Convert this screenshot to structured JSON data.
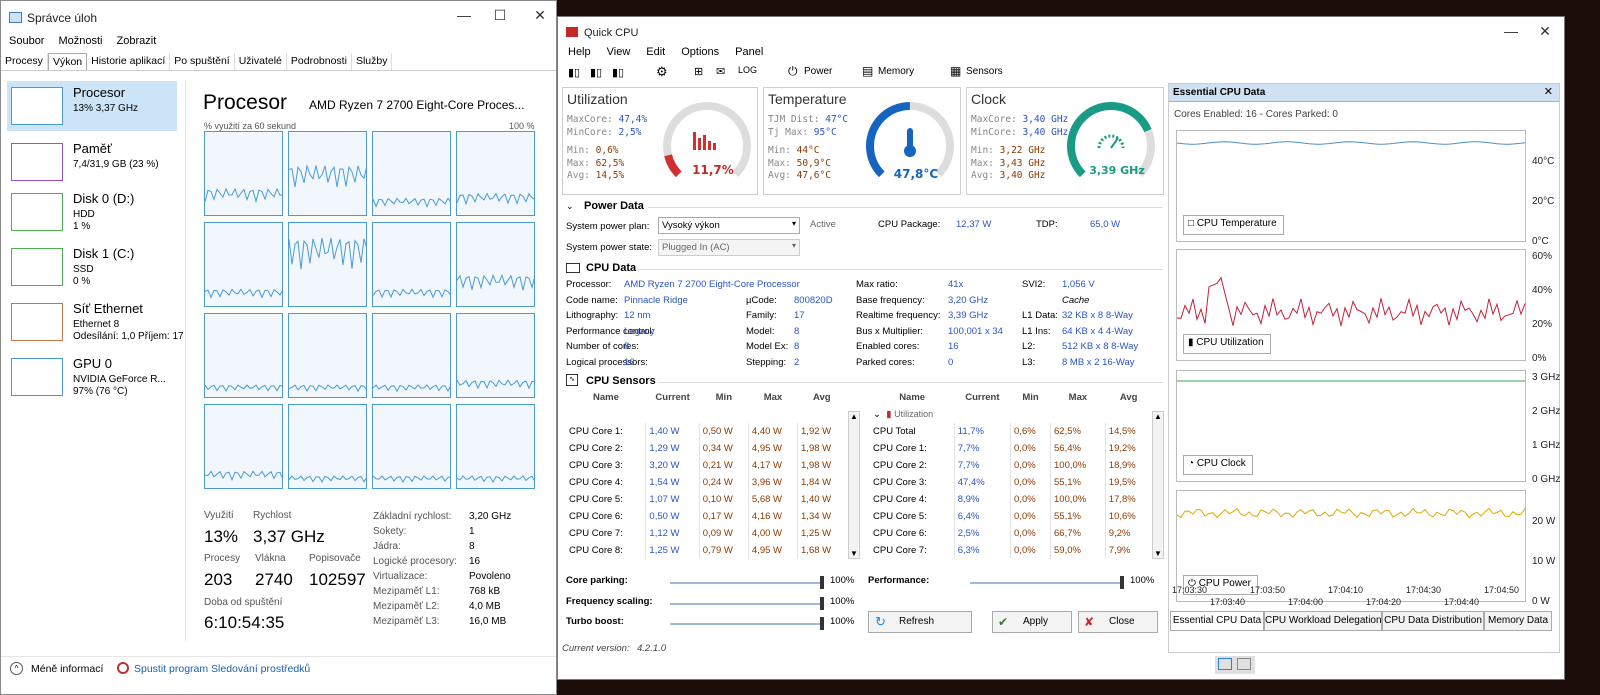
{
  "colors": {
    "accent": "#2a82da",
    "cpuBlue": "#4a9ad4",
    "memPurple": "#a04fc7",
    "diskGreen": "#4caf50",
    "netOrange": "#c5784a",
    "red": "#d32f2f",
    "tempBlue": "#1565c0",
    "clockTeal": "#1a9b86",
    "utilRed": "#c51f3a",
    "powerGold": "#e0a800",
    "cpuTempLine": "#4a90c8"
  },
  "taskmgr": {
    "title": "Správce úloh",
    "menu": [
      "Soubor",
      "Možnosti",
      "Zobrazit"
    ],
    "tabs": [
      "Procesy",
      "Výkon",
      "Historie aplikací",
      "Po spuštění",
      "Uživatelé",
      "Podrobnosti",
      "Služby"
    ],
    "active_tab": "Výkon",
    "sidebar": [
      {
        "name": "Procesor",
        "line1": "13% 3,37 GHz",
        "line2": "",
        "color": "#4a9ad4",
        "icon": "cpu-graph-icon"
      },
      {
        "name": "Paměť",
        "line1": "7,4/31,9 GB (23 %)",
        "line2": "",
        "color": "#a04fc7",
        "icon": "memory-graph-icon"
      },
      {
        "name": "Disk 0 (D:)",
        "line1": "HDD",
        "line2": "1 %",
        "color": "#4caf50",
        "icon": "disk-graph-icon"
      },
      {
        "name": "Disk 1 (C:)",
        "line1": "SSD",
        "line2": "0 %",
        "color": "#4caf50",
        "icon": "disk-graph-icon"
      },
      {
        "name": "Síť Ethernet",
        "line1": "Ethernet 8",
        "line2": "Odesílání: 1,0 Příjem: 17",
        "color": "#c5784a",
        "icon": "network-graph-icon"
      },
      {
        "name": "GPU 0",
        "line1": "NVIDIA GeForce R...",
        "line2": "97% (76 °C)",
        "color": "#4a9ad4",
        "icon": "gpu-graph-icon"
      }
    ],
    "heading": "Procesor",
    "cpu_model": "AMD Ryzen 7 2700 Eight-Core Proces...",
    "graph_caption": "% využití za 60 sekund",
    "graph_max": "100 %",
    "cell_levels": [
      0.3,
      0.55,
      0.2,
      0.25,
      0.2,
      0.75,
      0.2,
      0.35,
      0.15,
      0.15,
      0.15,
      0.2,
      0.2,
      0.15,
      0.15,
      0.15
    ],
    "stats": {
      "util_label": "Využití",
      "util_value": "13%",
      "speed_label": "Rychlost",
      "speed_value": "3,37 GHz",
      "proc_label": "Procesy",
      "proc_value": "203",
      "threads_label": "Vlákna",
      "threads_value": "2740",
      "handles_label": "Popisovače",
      "handles_value": "102597",
      "uptime_label": "Doba od spuštění",
      "uptime_value": "6:10:54:35"
    },
    "details": [
      {
        "k": "Základní rychlost:",
        "v": "3,20 GHz"
      },
      {
        "k": "Sokety:",
        "v": "1"
      },
      {
        "k": "Jádra:",
        "v": "8"
      },
      {
        "k": "Logické procesory:",
        "v": "16"
      },
      {
        "k": "Virtualizace:",
        "v": "Povoleno"
      },
      {
        "k": "Mezipaměť L1:",
        "v": "768 kB"
      },
      {
        "k": "Mezipaměť L2:",
        "v": "4,0 MB"
      },
      {
        "k": "Mezipaměť L3:",
        "v": "16,0 MB"
      }
    ],
    "footer_less": "Méně informací",
    "footer_monitor": "Spustit program Sledování prostředků"
  },
  "quickcpu": {
    "title": "Quick CPU",
    "menu": [
      "Help",
      "View",
      "Edit",
      "Options",
      "Panel"
    ],
    "toolbar": {
      "power": "Power",
      "memory": "Memory",
      "sensors": "Sensors"
    },
    "util": {
      "title": "Utilization",
      "lines": [
        [
          "MaxCore:",
          "47,4%"
        ],
        [
          "MinCore:",
          "2,5%"
        ],
        [
          "Min:",
          "0,6%"
        ],
        [
          "Max:",
          "62,5%"
        ],
        [
          "Avg:",
          "14,5%"
        ]
      ],
      "value": "11,7%",
      "level": 0.117
    },
    "temp": {
      "title": "Temperature",
      "lines": [
        [
          "TJM Dist:",
          "47°C"
        ],
        [
          "Tj Max:",
          "95°C"
        ],
        [
          "Min:",
          "44°C"
        ],
        [
          "Max:",
          "50,9°C"
        ],
        [
          "Avg:",
          "47,6°C"
        ]
      ],
      "value": "47,8°C",
      "level": 0.5
    },
    "clock": {
      "title": "Clock",
      "lines": [
        [
          "MaxCore:",
          "3,40 GHz"
        ],
        [
          "MinCore:",
          "3,40 GHz"
        ],
        [
          "Min:",
          "3,22 GHz"
        ],
        [
          "Max:",
          "3,43 GHz"
        ],
        [
          "Avg:",
          "3,40 GHz"
        ]
      ],
      "value": "3,39 GHz",
      "level": 0.75
    },
    "power_data": {
      "header": "Power Data",
      "plan_label": "System power plan:",
      "plan_value": "Vysoký výkon",
      "plan_state": "Active",
      "state_label": "System power state:",
      "state_value": "Plugged In (AC)",
      "pkg_label": "CPU Package:",
      "pkg_value": "12,37 W",
      "tdp_label": "TDP:",
      "tdp_value": "65,0 W"
    },
    "cpu_data": {
      "header": "CPU Data",
      "col1": [
        [
          "Processor:",
          "AMD Ryzen 7 2700 Eight-Core Processor"
        ],
        [
          "Code name:",
          "Pinnacle Ridge"
        ],
        [
          "Lithography:",
          "12 nm"
        ],
        [
          "Performance control:",
          "Legacy"
        ],
        [
          "Number of cores:",
          "8"
        ],
        [
          "Logical processors:",
          "16"
        ]
      ],
      "col2": [
        [
          "",
          ""
        ],
        [
          "µCode:",
          "800820D"
        ],
        [
          "Family:",
          "17"
        ],
        [
          "Model:",
          "8"
        ],
        [
          "Model Ex:",
          "8"
        ],
        [
          "Stepping:",
          "2"
        ]
      ],
      "col3": [
        [
          "Max ratio:",
          "41x"
        ],
        [
          "Base frequency:",
          "3,20 GHz"
        ],
        [
          "Realtime frequency:",
          "3,39 GHz"
        ],
        [
          "Bus x Multiplier:",
          "100,001 x 34"
        ],
        [
          "Enabled cores:",
          "16"
        ],
        [
          "Parked cores:",
          "0"
        ]
      ],
      "col4": [
        [
          "SVI2:",
          "1,056 V"
        ],
        [
          "",
          "Cache"
        ],
        [
          "L1 Data:",
          "32 KB x 8  8-Way"
        ],
        [
          "L1 Ins:",
          "64 KB x 4  4-Way"
        ],
        [
          "L2:",
          "512 KB x 8  8-Way"
        ],
        [
          "L3:",
          "8 MB x 2  16-Way"
        ]
      ]
    },
    "sensors": {
      "header": "CPU Sensors",
      "cols": [
        "Name",
        "Current",
        "Min",
        "Max",
        "Avg"
      ],
      "power_rows": [
        [
          "CPU Core 1:",
          "1,40 W",
          "0,50 W",
          "4,40 W",
          "1,92 W"
        ],
        [
          "CPU Core 2:",
          "1,29 W",
          "0,34 W",
          "4,95 W",
          "1,98 W"
        ],
        [
          "CPU Core 3:",
          "3,20 W",
          "0,21 W",
          "4,17 W",
          "1,98 W"
        ],
        [
          "CPU Core 4:",
          "1,54 W",
          "0,24 W",
          "3,96 W",
          "1,84 W"
        ],
        [
          "CPU Core 5:",
          "1,07 W",
          "0,10 W",
          "5,68 W",
          "1,40 W"
        ],
        [
          "CPU Core 6:",
          "0,50 W",
          "0,17 W",
          "4,16 W",
          "1,34 W"
        ],
        [
          "CPU Core 7:",
          "1,12 W",
          "0,09 W",
          "4,00 W",
          "1,25 W"
        ],
        [
          "CPU Core 8:",
          "1,25 W",
          "0,79 W",
          "4,95 W",
          "1,68 W"
        ]
      ],
      "util_group": "Utilization",
      "util_rows": [
        [
          "CPU Total",
          "11,7%",
          "0,6%",
          "62,5%",
          "14,5%"
        ],
        [
          "CPU Core 1:",
          "7,7%",
          "0,0%",
          "56,4%",
          "19,2%"
        ],
        [
          "CPU Core 2:",
          "7,7%",
          "0,0%",
          "100,0%",
          "18,9%"
        ],
        [
          "CPU Core 3:",
          "47,4%",
          "0,0%",
          "55,1%",
          "19,5%"
        ],
        [
          "CPU Core 4:",
          "8,9%",
          "0,0%",
          "100,0%",
          "17,8%"
        ],
        [
          "CPU Core 5:",
          "6,4%",
          "0,0%",
          "55,1%",
          "10,6%"
        ],
        [
          "CPU Core 6:",
          "2,5%",
          "0,0%",
          "66,7%",
          "9,2%"
        ],
        [
          "CPU Core 7:",
          "6,3%",
          "0,0%",
          "59,0%",
          "7,9%"
        ]
      ]
    },
    "sliders": [
      {
        "label": "Core parking:",
        "value": "100%",
        "level": 1
      },
      {
        "label": "Frequency scaling:",
        "value": "100%",
        "level": 1
      },
      {
        "label": "Turbo boost:",
        "value": "100%",
        "level": 1
      },
      {
        "label": "Performance:",
        "value": "100%",
        "level": 1
      }
    ],
    "buttons": {
      "refresh": "Refresh",
      "apply": "Apply",
      "close": "Close"
    },
    "version_label": "Current version:",
    "version_value": "4.2.1.0",
    "essential": {
      "title": "Essential CPU Data",
      "cores": "Cores Enabled: 16 - Cores Parked: 0",
      "charts": [
        {
          "tag": "CPU Temperature",
          "ticks": [
            "40°C",
            "20°C",
            "0°C"
          ],
          "icon": "thermometer-icon"
        },
        {
          "tag": "CPU Utilization",
          "ticks": [
            "60%",
            "40%",
            "20%",
            "0%"
          ],
          "icon": "bar-chart-icon"
        },
        {
          "tag": "CPU Clock",
          "ticks": [
            "3 GHz",
            "2 GHz",
            "1 GHz",
            "0 GHz"
          ],
          "icon": "gauge-icon"
        },
        {
          "tag": "CPU Power",
          "ticks": [
            "20 W",
            "10 W",
            "0 W"
          ],
          "icon": "power-icon"
        }
      ],
      "times_top": [
        "17:03:30",
        "17:03:50",
        "17:04:10",
        "17:04:30",
        "17:04:50"
      ],
      "times_bottom": [
        "17:03:40",
        "17:04:00",
        "17:04:20",
        "17:04:40"
      ],
      "tabs": [
        "Essential CPU Data",
        "CPU Workload Delegation",
        "CPU Data Distribution",
        "Memory Data"
      ]
    }
  }
}
